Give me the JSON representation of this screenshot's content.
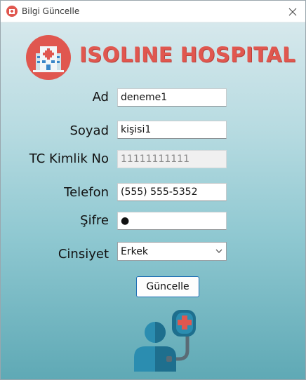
{
  "window": {
    "title": "Bilgi Güncelle"
  },
  "logo": {
    "text": "ISOLINE HOSPITAL",
    "accent_color": "#e0574f"
  },
  "form": {
    "ad": {
      "label": "Ad",
      "value": "deneme1"
    },
    "soyad": {
      "label": "Soyad",
      "value": "kişisi1"
    },
    "tc": {
      "label": "TC Kimlik No",
      "value": "11111111111",
      "disabled": true
    },
    "telefon": {
      "label": "Telefon",
      "value": "(555) 555-5352"
    },
    "sifre": {
      "label": "Şifre",
      "value": "●"
    },
    "cinsiyet": {
      "label": "Cinsiyet",
      "selected": "Erkek"
    },
    "submit_label": "Güncelle"
  },
  "icons": {
    "app": "hospital-icon",
    "close": "close-icon",
    "dropdown": "chevron-down-icon",
    "illustration": "doctor-stethoscope-icon"
  }
}
